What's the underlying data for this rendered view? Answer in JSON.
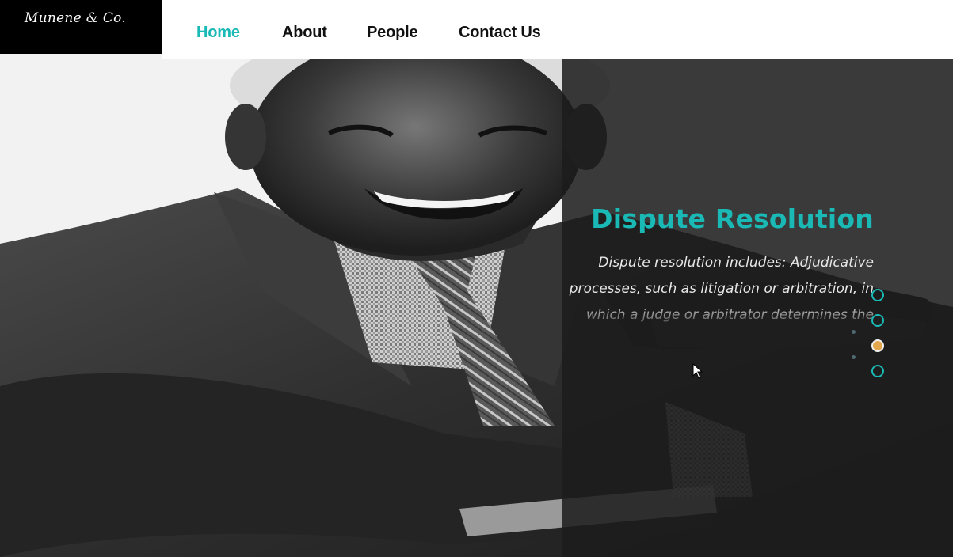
{
  "brand": {
    "name": "Munene & Co."
  },
  "nav": {
    "items": [
      {
        "label": "Home",
        "active": true
      },
      {
        "label": "About",
        "active": false
      },
      {
        "label": "People",
        "active": false
      },
      {
        "label": "Contact Us",
        "active": false
      }
    ]
  },
  "hero": {
    "title": "Dispute Resolution",
    "text": "Dispute resolution includes: Adjudicative processes, such as litigation or arbitration, in which a judge or arbitrator determines the outcome. Consensual processes, such as collaborative law, mediation and negotiation.",
    "active_slide": 3,
    "slide_count": 4
  },
  "colors": {
    "accent": "#1ab9b5",
    "active_dot": "#e2a74c",
    "overlay": "#1c1c1c",
    "logo_bg": "#000000"
  }
}
